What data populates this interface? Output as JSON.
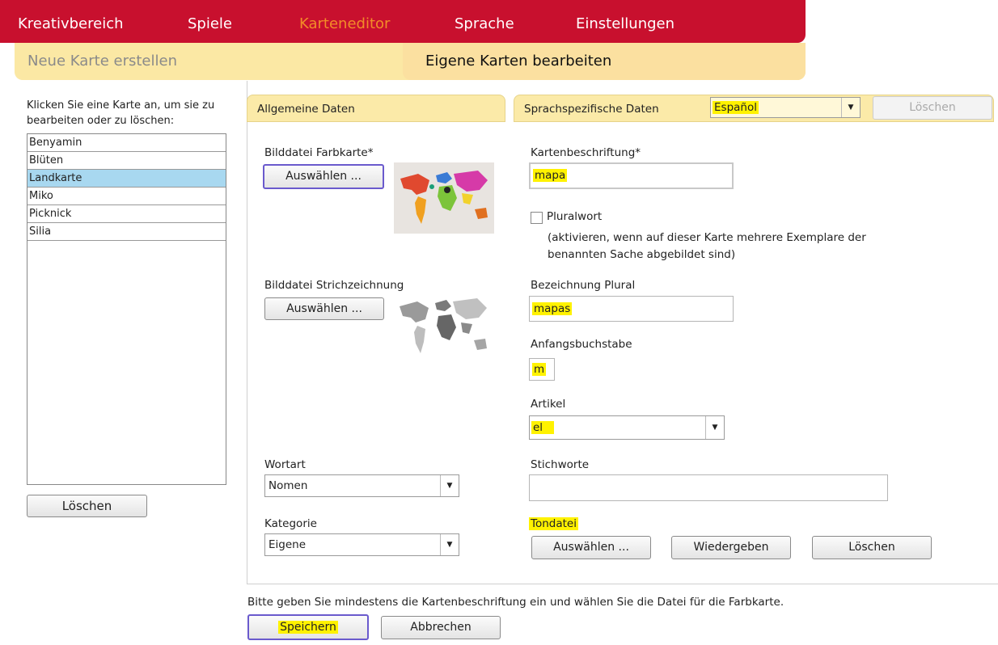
{
  "nav": {
    "items": [
      "Kreativbereich",
      "Spiele",
      "Karteneditor",
      "Sprache",
      "Einstellungen"
    ],
    "active": "Karteneditor"
  },
  "subnav": {
    "new_card": "Neue Karte erstellen",
    "edit_cards": "Eigene Karten bearbeiten"
  },
  "left": {
    "hint": "Klicken Sie eine Karte an, um sie zu bearbeiten oder zu löschen:",
    "cards": [
      "Benyamin",
      "Blüten",
      "Landkarte",
      "Miko",
      "Picknick",
      "Silia"
    ],
    "selected": "Landkarte",
    "delete_label": "Löschen"
  },
  "tabs": {
    "general": "Allgemeine Daten",
    "language": "Sprachspezifische Daten",
    "language_value": "Español",
    "language_delete": "Löschen"
  },
  "general": {
    "color_image_label": "Bilddatei Farbkarte*",
    "color_image_button": "Auswählen ...",
    "line_image_label": "Bilddatei Strichzeichnung",
    "line_image_button": "Auswählen ...",
    "word_type_label": "Wortart",
    "word_type_value": "Nomen",
    "category_label": "Kategorie",
    "category_value": "Eigene"
  },
  "language": {
    "caption_label": "Kartenbeschriftung*",
    "caption_value": "mapa",
    "plural_checkbox_label": "Pluralwort",
    "plural_hint_1": "(aktivieren, wenn auf dieser Karte mehrere Exemplare der",
    "plural_hint_2": "benannten Sache abgebildet sind)",
    "plural_label": "Bezeichnung Plural",
    "plural_value": "mapas",
    "initial_label": "Anfangsbuchstabe",
    "initial_value": "m",
    "article_label": "Artikel",
    "article_value": "el",
    "keywords_label": "Stichworte",
    "keywords_value": "",
    "sound_label": "Tondatei",
    "sound_select": "Auswählen ...",
    "sound_play": "Wiedergeben",
    "sound_delete": "Löschen"
  },
  "footer": {
    "hint": "Bitte geben Sie mindestens die Kartenbeschriftung ein und wählen Sie die Datei für die Farbkarte.",
    "save": "Speichern",
    "cancel": "Abbrechen"
  },
  "colors": {
    "nav_red": "#c8102e",
    "nav_active": "#f28c28",
    "subnav_yellow": "#fbe8a4",
    "selection_blue": "#a8d8f0",
    "highlight": "#fff200"
  }
}
